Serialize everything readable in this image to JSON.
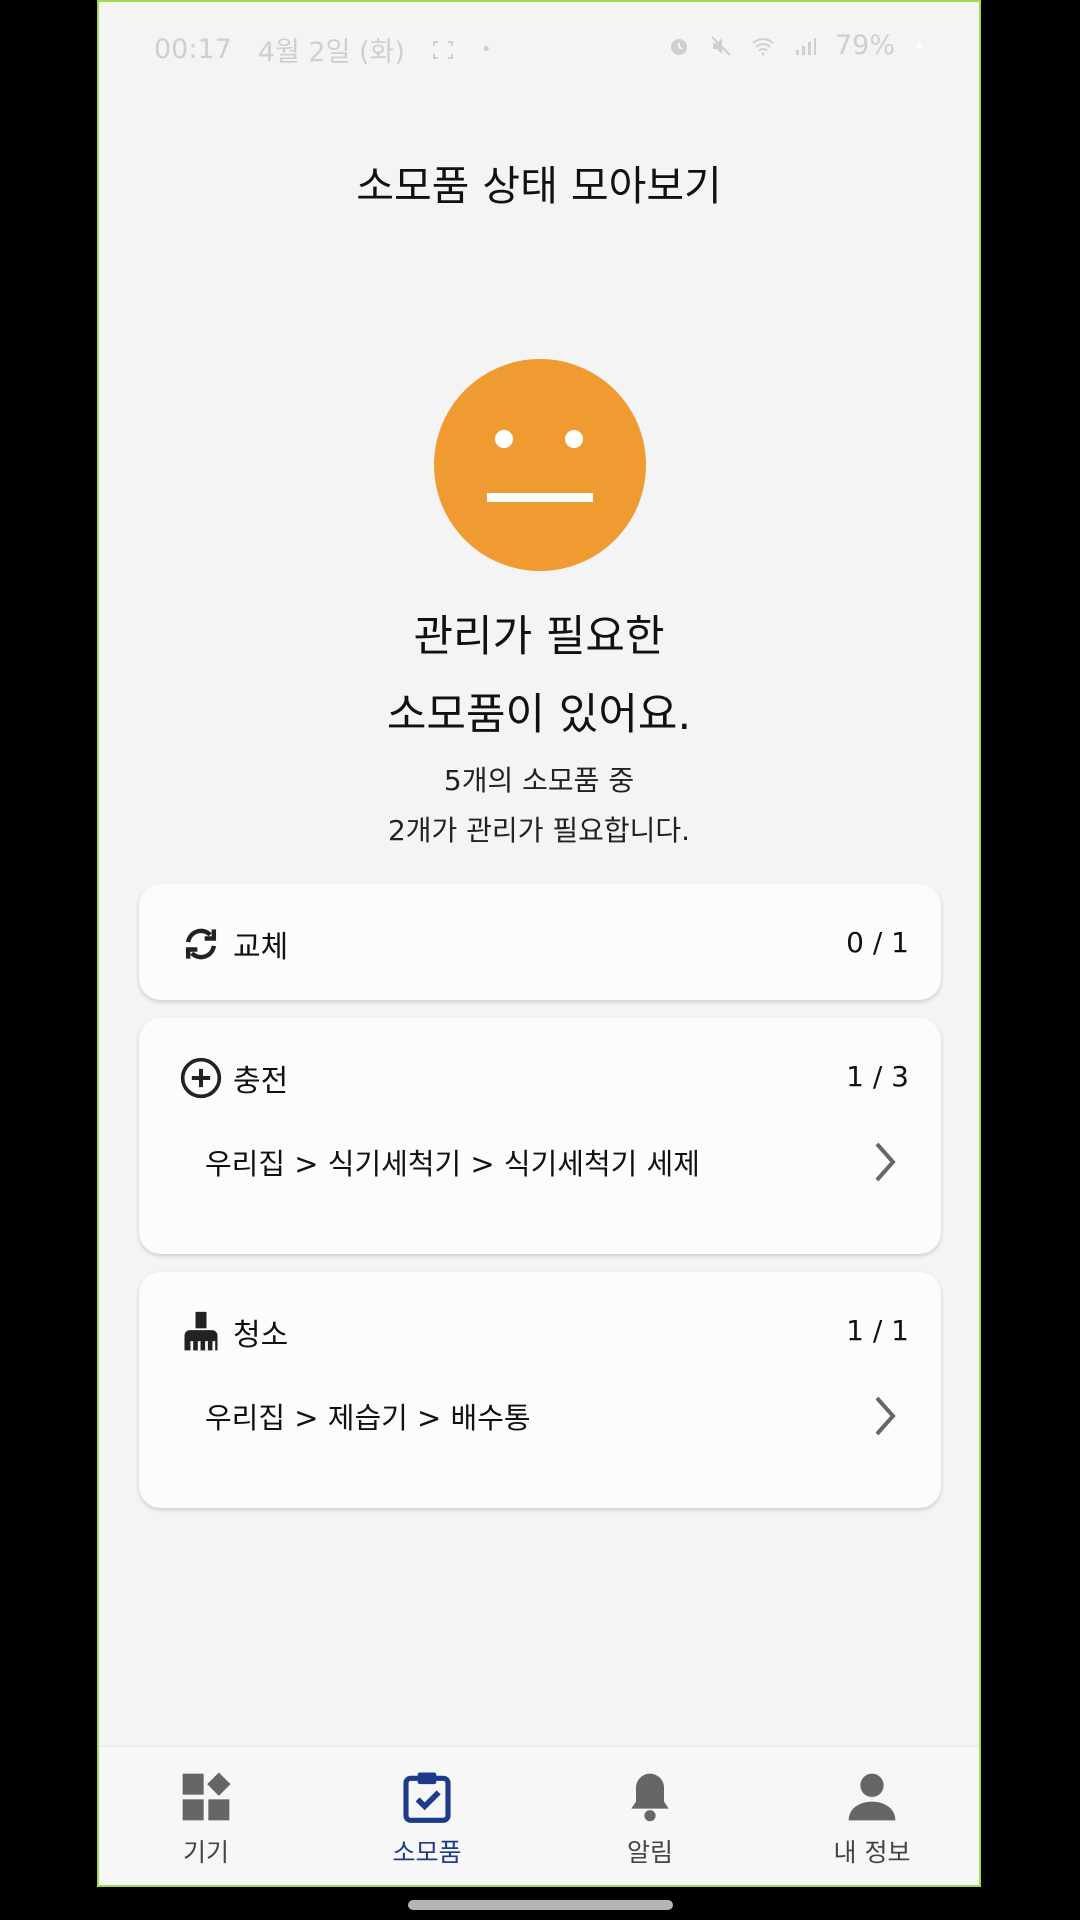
{
  "status_bar": {
    "time": "00:17",
    "date": "4월 2일 (화)",
    "battery": "79%"
  },
  "page": {
    "title": "소모품 상태 모아보기",
    "headline_line1": "관리가 필요한",
    "headline_line2": "소모품이 있어요.",
    "sub_line1": "5개의 소모품 중",
    "sub_line2": "2개가 관리가 필요합니다.",
    "status_face_color": "#f09a32"
  },
  "cards": {
    "replace": {
      "label": "교체",
      "count": "0 / 1"
    },
    "charge": {
      "label": "충전",
      "count": "1 / 3",
      "item": "우리집 > 식기세척기 > 식기세척기 세제"
    },
    "clean": {
      "label": "청소",
      "count": "1 / 1",
      "item": "우리집 > 제습기 > 배수통"
    }
  },
  "nav": {
    "devices": "기기",
    "consumables": "소모품",
    "alerts": "알림",
    "profile": "내 정보",
    "active": "consumables",
    "active_color": "#1e3a8a",
    "inactive_color": "#666666"
  }
}
